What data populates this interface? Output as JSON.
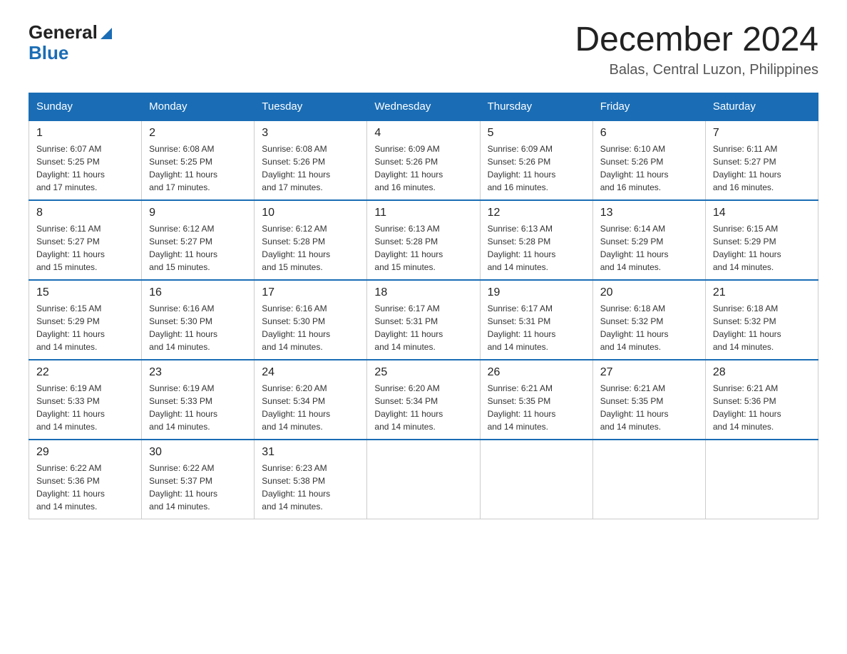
{
  "header": {
    "logo_general": "General",
    "logo_blue": "Blue",
    "month_title": "December 2024",
    "location": "Balas, Central Luzon, Philippines"
  },
  "columns": [
    "Sunday",
    "Monday",
    "Tuesday",
    "Wednesday",
    "Thursday",
    "Friday",
    "Saturday"
  ],
  "weeks": [
    [
      {
        "day": "1",
        "sunrise": "6:07 AM",
        "sunset": "5:25 PM",
        "daylight": "11 hours and 17 minutes."
      },
      {
        "day": "2",
        "sunrise": "6:08 AM",
        "sunset": "5:25 PM",
        "daylight": "11 hours and 17 minutes."
      },
      {
        "day": "3",
        "sunrise": "6:08 AM",
        "sunset": "5:26 PM",
        "daylight": "11 hours and 17 minutes."
      },
      {
        "day": "4",
        "sunrise": "6:09 AM",
        "sunset": "5:26 PM",
        "daylight": "11 hours and 16 minutes."
      },
      {
        "day": "5",
        "sunrise": "6:09 AM",
        "sunset": "5:26 PM",
        "daylight": "11 hours and 16 minutes."
      },
      {
        "day": "6",
        "sunrise": "6:10 AM",
        "sunset": "5:26 PM",
        "daylight": "11 hours and 16 minutes."
      },
      {
        "day": "7",
        "sunrise": "6:11 AM",
        "sunset": "5:27 PM",
        "daylight": "11 hours and 16 minutes."
      }
    ],
    [
      {
        "day": "8",
        "sunrise": "6:11 AM",
        "sunset": "5:27 PM",
        "daylight": "11 hours and 15 minutes."
      },
      {
        "day": "9",
        "sunrise": "6:12 AM",
        "sunset": "5:27 PM",
        "daylight": "11 hours and 15 minutes."
      },
      {
        "day": "10",
        "sunrise": "6:12 AM",
        "sunset": "5:28 PM",
        "daylight": "11 hours and 15 minutes."
      },
      {
        "day": "11",
        "sunrise": "6:13 AM",
        "sunset": "5:28 PM",
        "daylight": "11 hours and 15 minutes."
      },
      {
        "day": "12",
        "sunrise": "6:13 AM",
        "sunset": "5:28 PM",
        "daylight": "11 hours and 14 minutes."
      },
      {
        "day": "13",
        "sunrise": "6:14 AM",
        "sunset": "5:29 PM",
        "daylight": "11 hours and 14 minutes."
      },
      {
        "day": "14",
        "sunrise": "6:15 AM",
        "sunset": "5:29 PM",
        "daylight": "11 hours and 14 minutes."
      }
    ],
    [
      {
        "day": "15",
        "sunrise": "6:15 AM",
        "sunset": "5:29 PM",
        "daylight": "11 hours and 14 minutes."
      },
      {
        "day": "16",
        "sunrise": "6:16 AM",
        "sunset": "5:30 PM",
        "daylight": "11 hours and 14 minutes."
      },
      {
        "day": "17",
        "sunrise": "6:16 AM",
        "sunset": "5:30 PM",
        "daylight": "11 hours and 14 minutes."
      },
      {
        "day": "18",
        "sunrise": "6:17 AM",
        "sunset": "5:31 PM",
        "daylight": "11 hours and 14 minutes."
      },
      {
        "day": "19",
        "sunrise": "6:17 AM",
        "sunset": "5:31 PM",
        "daylight": "11 hours and 14 minutes."
      },
      {
        "day": "20",
        "sunrise": "6:18 AM",
        "sunset": "5:32 PM",
        "daylight": "11 hours and 14 minutes."
      },
      {
        "day": "21",
        "sunrise": "6:18 AM",
        "sunset": "5:32 PM",
        "daylight": "11 hours and 14 minutes."
      }
    ],
    [
      {
        "day": "22",
        "sunrise": "6:19 AM",
        "sunset": "5:33 PM",
        "daylight": "11 hours and 14 minutes."
      },
      {
        "day": "23",
        "sunrise": "6:19 AM",
        "sunset": "5:33 PM",
        "daylight": "11 hours and 14 minutes."
      },
      {
        "day": "24",
        "sunrise": "6:20 AM",
        "sunset": "5:34 PM",
        "daylight": "11 hours and 14 minutes."
      },
      {
        "day": "25",
        "sunrise": "6:20 AM",
        "sunset": "5:34 PM",
        "daylight": "11 hours and 14 minutes."
      },
      {
        "day": "26",
        "sunrise": "6:21 AM",
        "sunset": "5:35 PM",
        "daylight": "11 hours and 14 minutes."
      },
      {
        "day": "27",
        "sunrise": "6:21 AM",
        "sunset": "5:35 PM",
        "daylight": "11 hours and 14 minutes."
      },
      {
        "day": "28",
        "sunrise": "6:21 AM",
        "sunset": "5:36 PM",
        "daylight": "11 hours and 14 minutes."
      }
    ],
    [
      {
        "day": "29",
        "sunrise": "6:22 AM",
        "sunset": "5:36 PM",
        "daylight": "11 hours and 14 minutes."
      },
      {
        "day": "30",
        "sunrise": "6:22 AM",
        "sunset": "5:37 PM",
        "daylight": "11 hours and 14 minutes."
      },
      {
        "day": "31",
        "sunrise": "6:23 AM",
        "sunset": "5:38 PM",
        "daylight": "11 hours and 14 minutes."
      },
      null,
      null,
      null,
      null
    ]
  ],
  "labels": {
    "sunrise": "Sunrise: ",
    "sunset": "Sunset: ",
    "daylight": "Daylight: "
  }
}
